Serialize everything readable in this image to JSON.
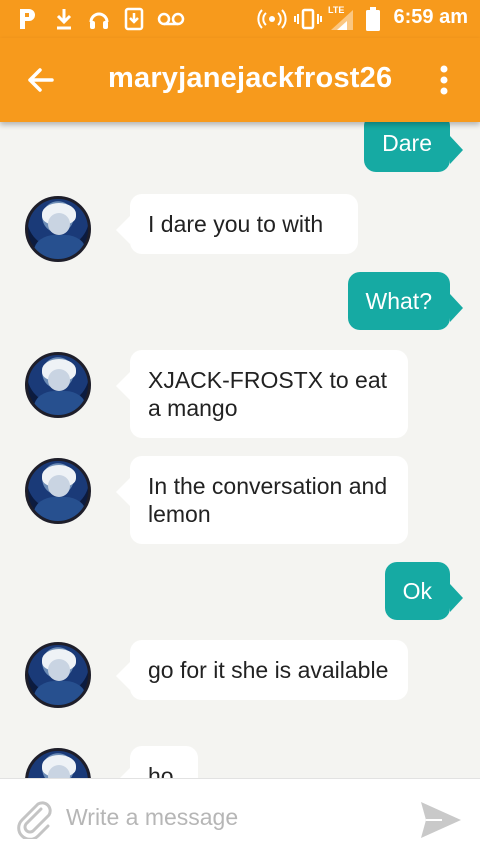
{
  "status_bar": {
    "time": "6:59 am",
    "network_label": "LTE",
    "icons": [
      "pandora-icon",
      "download-icon",
      "headset-icon",
      "download-box-icon",
      "voicemail-icon",
      "hotspot-icon",
      "vibrate-icon",
      "signal-icon",
      "battery-icon"
    ]
  },
  "header": {
    "title": "maryjanejackfrost26",
    "back_icon": "arrow-left-icon",
    "menu_icon": "more-vert-icon",
    "color": "#f79a1c"
  },
  "messages": [
    {
      "side": "out",
      "text": "Dare"
    },
    {
      "side": "in",
      "text": "I dare you to with"
    },
    {
      "side": "out",
      "text": "What?"
    },
    {
      "side": "in",
      "text": "XJACK-FROSTX to eat a mango"
    },
    {
      "side": "in",
      "text": "In the conversation and lemon"
    },
    {
      "side": "out",
      "text": "Ok"
    },
    {
      "side": "in",
      "text": "go for it she is available"
    },
    {
      "side": "in",
      "text": "ho"
    }
  ],
  "colors": {
    "outgoing_bubble": "#16aaa3",
    "incoming_bubble": "#ffffff",
    "background": "#f4f4f1"
  },
  "composer": {
    "placeholder": "Write a message",
    "attach_icon": "paperclip-icon",
    "send_icon": "send-icon"
  }
}
